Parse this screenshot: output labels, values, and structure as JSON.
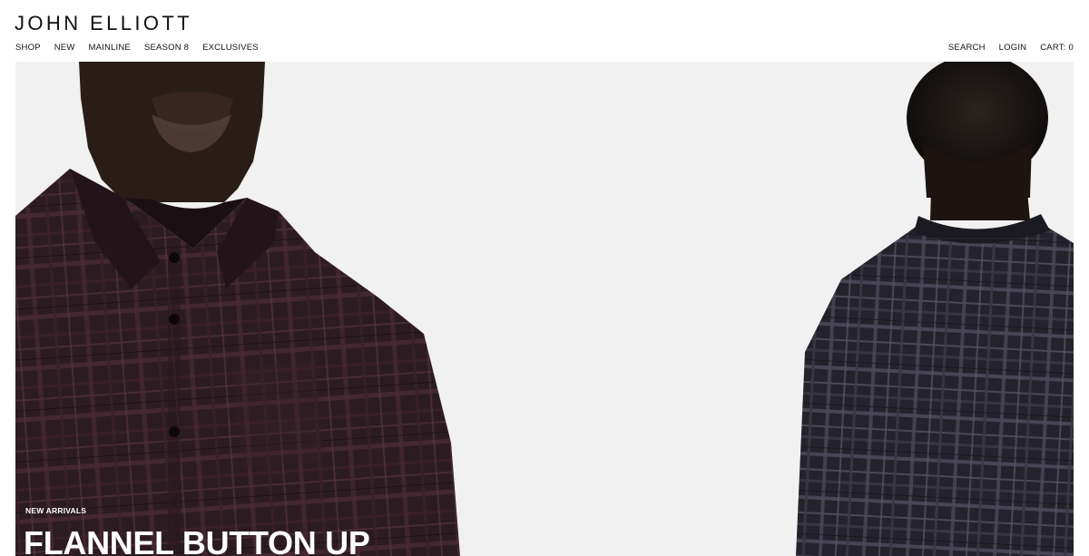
{
  "brand": {
    "logo_text": "JOHN ELLIOTT"
  },
  "nav": {
    "primary": [
      {
        "label": "SHOP"
      },
      {
        "label": "NEW"
      },
      {
        "label": "MAINLINE"
      },
      {
        "label": "SEASON 8"
      },
      {
        "label": "EXCLUSIVES"
      }
    ],
    "utility": {
      "search_label": "SEARCH",
      "login_label": "LOGIN",
      "cart_label": "CART:",
      "cart_count": "0"
    }
  },
  "hero": {
    "eyebrow": "NEW ARRIVALS",
    "title": "FLANNEL BUTTON UP",
    "colors": {
      "background": "#f1f1f1",
      "skin": "#2a1d17",
      "shirt_left": "#2c1c22",
      "shirt_right": "#24222b",
      "text": "#ffffff"
    }
  }
}
